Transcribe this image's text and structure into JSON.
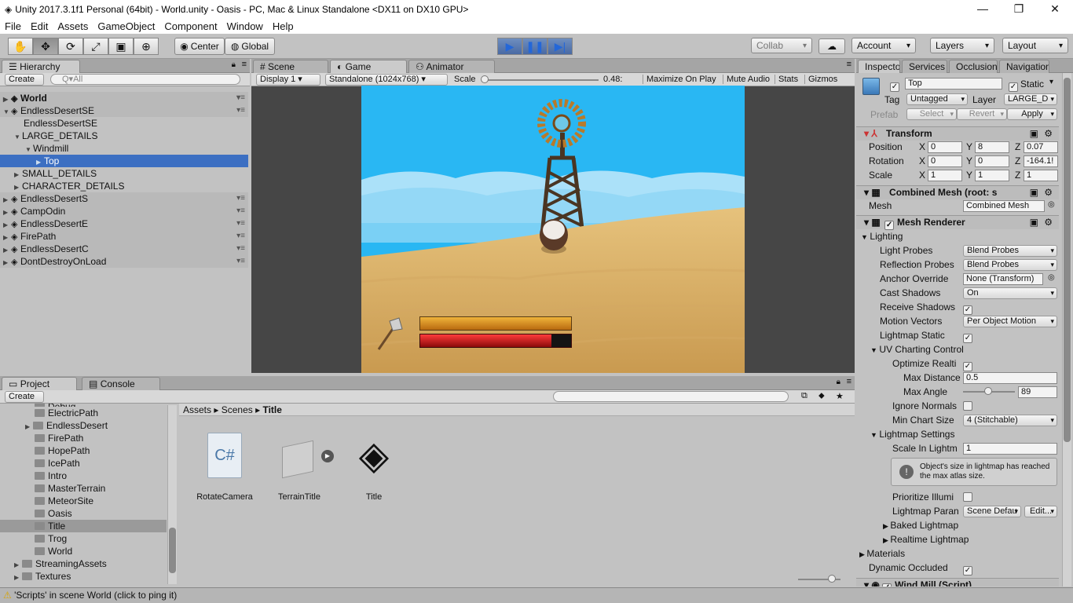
{
  "window": {
    "title": "Unity 2017.3.1f1 Personal (64bit) - World.unity - Oasis - PC, Mac & Linux Standalone <DX11 on DX10 GPU>",
    "min": "—",
    "restore": "❐",
    "close": "✕"
  },
  "menu": [
    "File",
    "Edit",
    "Assets",
    "GameObject",
    "Component",
    "Window",
    "Help"
  ],
  "toolbar": {
    "center": "Center",
    "global": "Global",
    "collab": "Collab",
    "account": "Account",
    "layers": "Layers",
    "layout": "Layout"
  },
  "hierarchy": {
    "tab": "Hierarchy",
    "create": "Create",
    "search": "Q▾All",
    "rows": [
      "World",
      "EndlessDesertSE",
      "EndlessDesertSE",
      "LARGE_DETAILS",
      "Windmill",
      "Top",
      "SMALL_DETAILS",
      "CHARACTER_DETAILS",
      "EndlessDesertS",
      "CampOdin",
      "EndlessDesertE",
      "FirePath",
      "EndlessDesertC",
      "DontDestroyOnLoad"
    ]
  },
  "gametabs": {
    "scene": "Scene",
    "game": "Game",
    "animator": "Animator"
  },
  "gamebar": {
    "display": "Display 1",
    "resolution": "Standalone (1024x768)",
    "scale_label": "Scale",
    "scale_value": "0.48:",
    "maximize": "Maximize On Play",
    "mute": "Mute Audio",
    "stats": "Stats",
    "gizmos": "Gizmos"
  },
  "hud": {
    "bar1_fill": 1.0,
    "bar2_fill": 0.87,
    "bar1_color": "#e09a1a",
    "bar2_color": "#d01010"
  },
  "project": {
    "tab": "Project",
    "console": "Console",
    "create": "Create",
    "folders": [
      "Debug",
      "ElectricPath",
      "EndlessDesert",
      "FirePath",
      "HopePath",
      "IcePath",
      "Intro",
      "MasterTerrain",
      "MeteorSite",
      "Oasis",
      "Title",
      "Trog",
      "World",
      "StreamingAssets",
      "Textures"
    ],
    "breadcrumb": [
      "Assets",
      "Scenes",
      "Title"
    ],
    "assets": [
      "RotateCamera",
      "TerrainTitle",
      "Title"
    ]
  },
  "inspector": {
    "tabs": [
      "Inspector",
      "Services",
      "Occlusion",
      "Navigation"
    ],
    "name": "Top",
    "static": "Static",
    "tag_label": "Tag",
    "tag": "Untagged",
    "layer_label": "Layer",
    "layer": "LARGE_D",
    "prefab": "Prefab",
    "select": "Select",
    "revert": "Revert",
    "apply": "Apply",
    "transform": {
      "title": "Transform",
      "position": "Position",
      "rotation": "Rotation",
      "scale": "Scale",
      "px": "0",
      "py": "8",
      "pz": "0.07",
      "rx": "0",
      "ry": "0",
      "rz": "-164.1!",
      "sx": "1",
      "sy": "1",
      "sz": "1"
    },
    "mesh": {
      "title": "Combined Mesh (root: s",
      "label": "Mesh",
      "value": "Combined Mesh"
    },
    "renderer": {
      "title": "Mesh Renderer",
      "lighting": "Lighting",
      "light_probes": "Light Probes",
      "light_probes_v": "Blend Probes",
      "refl_probes": "Reflection Probes",
      "refl_probes_v": "Blend Probes",
      "anchor": "Anchor Override",
      "anchor_v": "None (Transform)",
      "cast": "Cast Shadows",
      "cast_v": "On",
      "receive": "Receive Shadows",
      "motion": "Motion Vectors",
      "motion_v": "Per Object Motion",
      "lm_static": "Lightmap Static",
      "uv": "UV Charting Control",
      "optimize": "Optimize Realti",
      "maxdist": "Max Distance",
      "maxdist_v": "0.5",
      "maxangle": "Max Angle",
      "maxangle_v": "89",
      "ignore": "Ignore Normals",
      "minchart": "Min Chart Size",
      "minchart_v": "4 (Stitchable)",
      "lmsettings": "Lightmap Settings",
      "scalein": "Scale In Lightm",
      "scalein_v": "1",
      "info": "Object's size in lightmap has reached the max atlas size.",
      "prior": "Prioritize Illumi",
      "lmparam": "Lightmap Paran",
      "lmparam_v": "Scene Defau",
      "edit": "Edit...",
      "baked": "Baked Lightmap",
      "realtime": "Realtime Lightmap",
      "materials": "Materials",
      "dynocc": "Dynamic Occluded",
      "windmill": "Wind Mill (Script)"
    }
  },
  "status": "'Scripts' in scene World (click to ping it)"
}
